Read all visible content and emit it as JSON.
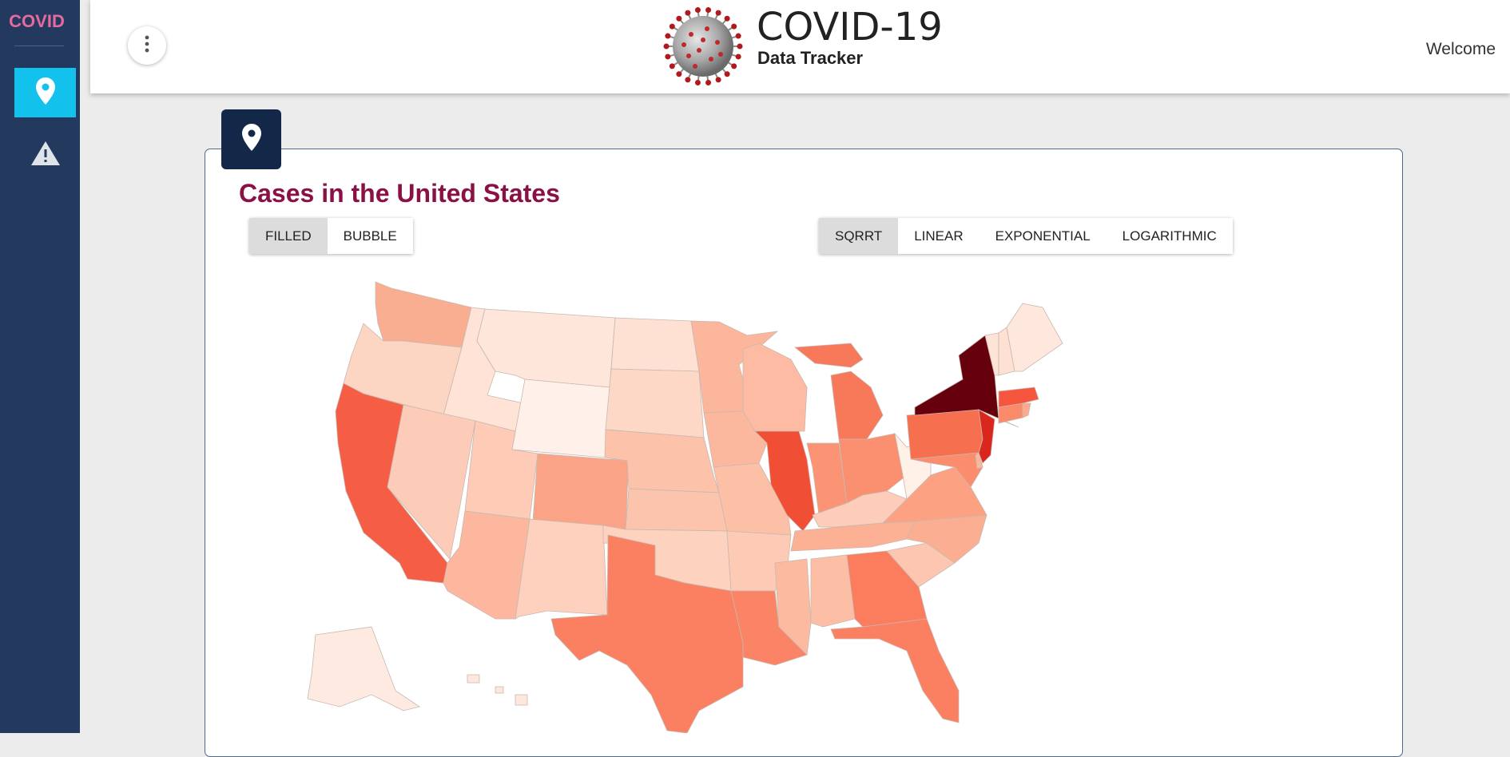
{
  "sidebar": {
    "brand": "COVID",
    "items": [
      {
        "icon": "map-pin-icon",
        "active": true
      },
      {
        "icon": "warning-icon",
        "active": false
      }
    ]
  },
  "header": {
    "title": "COVID-19",
    "subtitle": "Data Tracker",
    "welcome": "Welcome",
    "menu_icon": "more-vertical-icon",
    "logo_icon": "coronavirus-icon"
  },
  "panel": {
    "tab_icon": "map-pin-icon",
    "title": "Cases in the United States",
    "map_type_buttons": [
      {
        "label": "FILLED",
        "selected": true
      },
      {
        "label": "BUBBLE",
        "selected": false
      }
    ],
    "scale_buttons": [
      {
        "label": "SQRRT",
        "selected": true
      },
      {
        "label": "LINEAR",
        "selected": false
      },
      {
        "label": "EXPONENTIAL",
        "selected": false
      },
      {
        "label": "LOGARITHMIC",
        "selected": false
      }
    ]
  },
  "colors": {
    "sidebar": "#233a5e",
    "active_nav": "#13c2ec",
    "brand": "#e46aa0",
    "title": "#8b1046",
    "panel_tab": "#132848",
    "choropleth_low": "#fee7dc",
    "choropleth_high": "#67000d"
  },
  "map_data": {
    "type": "choropleth",
    "region": "United States",
    "scale": "sqrt",
    "states": [
      {
        "id": "WA",
        "fill": "#f9ad91"
      },
      {
        "id": "OR",
        "fill": "#fdd5c3"
      },
      {
        "id": "CA",
        "fill": "#f55d44"
      },
      {
        "id": "ID",
        "fill": "#fee3d6"
      },
      {
        "id": "NV",
        "fill": "#fdccb8"
      },
      {
        "id": "MT",
        "fill": "#fee6da"
      },
      {
        "id": "WY",
        "fill": "#fff1ea"
      },
      {
        "id": "UT",
        "fill": "#fdcbb6"
      },
      {
        "id": "AZ",
        "fill": "#fcb79e"
      },
      {
        "id": "CO",
        "fill": "#fba386"
      },
      {
        "id": "NM",
        "fill": "#fdd1be"
      },
      {
        "id": "ND",
        "fill": "#fee1d3"
      },
      {
        "id": "SD",
        "fill": "#fdd8c7"
      },
      {
        "id": "NE",
        "fill": "#fcc2aa"
      },
      {
        "id": "KS",
        "fill": "#fcc4ad"
      },
      {
        "id": "OK",
        "fill": "#fdd2bf"
      },
      {
        "id": "TX",
        "fill": "#fb7f61"
      },
      {
        "id": "MN",
        "fill": "#fcb69c"
      },
      {
        "id": "IA",
        "fill": "#fcb89f"
      },
      {
        "id": "MO",
        "fill": "#fcc0a7"
      },
      {
        "id": "AR",
        "fill": "#fdcab5"
      },
      {
        "id": "LA",
        "fill": "#fb8466"
      },
      {
        "id": "WI",
        "fill": "#fcbba2"
      },
      {
        "id": "IL",
        "fill": "#f14e36"
      },
      {
        "id": "MI",
        "fill": "#f8785a"
      },
      {
        "id": "IN",
        "fill": "#fb9475"
      },
      {
        "id": "OH",
        "fill": "#fb9070"
      },
      {
        "id": "KY",
        "fill": "#fdcdb9"
      },
      {
        "id": "TN",
        "fill": "#fcb195"
      },
      {
        "id": "MS",
        "fill": "#fcbba1"
      },
      {
        "id": "AL",
        "fill": "#fcbea5"
      },
      {
        "id": "GA",
        "fill": "#fb7d5e"
      },
      {
        "id": "FL",
        "fill": "#fb8061"
      },
      {
        "id": "SC",
        "fill": "#fdc6b0"
      },
      {
        "id": "NC",
        "fill": "#fcae92"
      },
      {
        "id": "VA",
        "fill": "#fca283"
      },
      {
        "id": "WV",
        "fill": "#fff0e8"
      },
      {
        "id": "PA",
        "fill": "#f6704f"
      },
      {
        "id": "NY",
        "fill": "#67000d"
      },
      {
        "id": "NJ",
        "fill": "#d9271e"
      },
      {
        "id": "MD",
        "fill": "#fb8c6d"
      },
      {
        "id": "DE",
        "fill": "#fcb69c"
      },
      {
        "id": "CT",
        "fill": "#fb8a6a"
      },
      {
        "id": "MA",
        "fill": "#f5563d"
      },
      {
        "id": "RI",
        "fill": "#fcaa8d"
      },
      {
        "id": "VT",
        "fill": "#fee4d7"
      },
      {
        "id": "NH",
        "fill": "#fee1d3"
      },
      {
        "id": "ME",
        "fill": "#fee8de"
      },
      {
        "id": "AK",
        "fill": "#feeae1"
      },
      {
        "id": "HI",
        "fill": "#fee7dc"
      }
    ]
  }
}
